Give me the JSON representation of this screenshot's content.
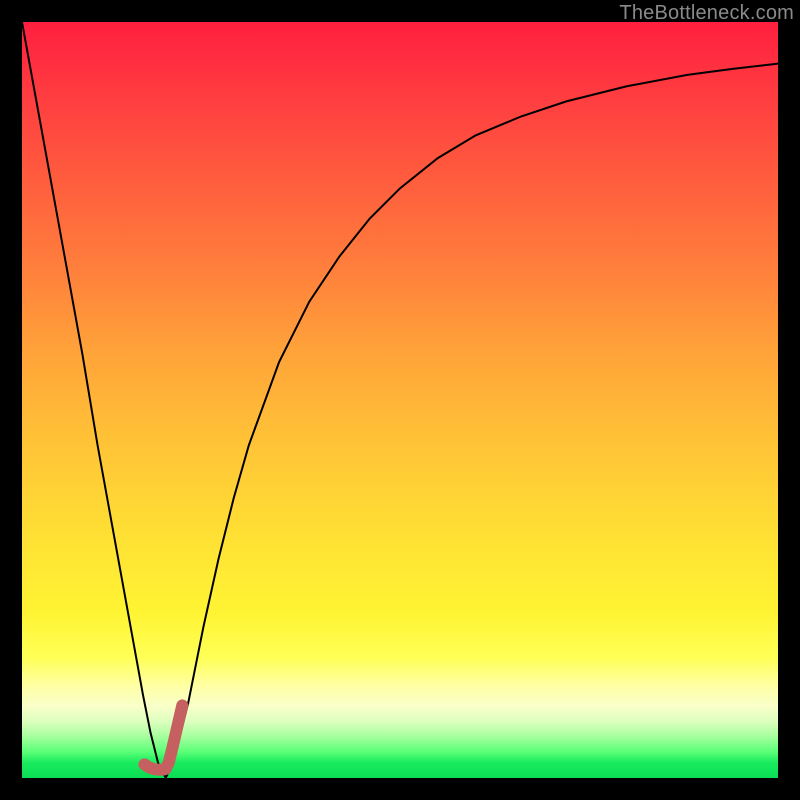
{
  "watermark": "TheBottleneck.com",
  "chart_data": {
    "type": "line",
    "title": "",
    "xlabel": "",
    "ylabel": "",
    "xlim": [
      0,
      100
    ],
    "ylim": [
      0,
      100
    ],
    "grid": false,
    "series": [
      {
        "name": "primary-curve",
        "color": "#000000",
        "width": 2,
        "x": [
          0,
          2,
          4,
          6,
          8,
          10,
          12,
          14,
          16,
          17,
          18,
          19,
          20,
          22,
          24,
          26,
          28,
          30,
          34,
          38,
          42,
          46,
          50,
          55,
          60,
          66,
          72,
          80,
          88,
          94,
          100
        ],
        "y": [
          100,
          89,
          78,
          67,
          56,
          44,
          33,
          22,
          11,
          6,
          2,
          0,
          2,
          10,
          20,
          29,
          37,
          44,
          55,
          63,
          69,
          74,
          78,
          82,
          85,
          87.5,
          89.5,
          91.5,
          93,
          93.8,
          94.5
        ]
      },
      {
        "name": "highlight-segment",
        "color": "#c66060",
        "width": 12,
        "linecap": "round",
        "x": [
          16.2,
          16.8,
          17.4,
          18.0,
          18.6,
          19.0,
          19.4,
          19.9,
          20.5,
          21.2
        ],
        "y": [
          1.8,
          1.4,
          1.2,
          1.1,
          1.1,
          1.2,
          2.0,
          4.0,
          6.6,
          9.6
        ]
      }
    ]
  }
}
